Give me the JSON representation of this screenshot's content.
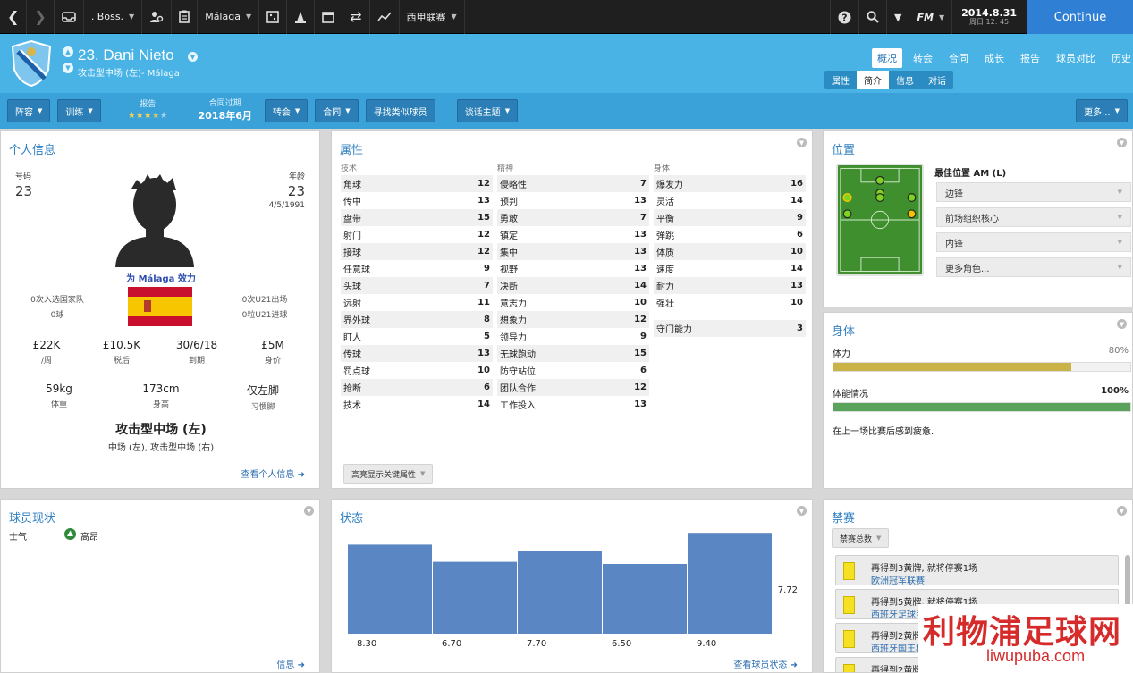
{
  "topbar": {
    "manager": ". Boss.",
    "club": "Málaga",
    "league": "西甲联赛",
    "game_menu": "FM",
    "date": "2014.8.31",
    "day_time": "周日 12: 45",
    "continue_label": "Continue"
  },
  "player": {
    "name": "23. Dani Nieto",
    "subtitle": "攻击型中场 (左)- Málaga"
  },
  "main_tabs": [
    "概况",
    "转会",
    "合同",
    "成长",
    "报告",
    "球员对比",
    "历史"
  ],
  "sub_tabs": [
    "属性",
    "简介",
    "信息",
    "对话"
  ],
  "actionbar": {
    "squad": "阵容",
    "training": "训练",
    "report_label": "报告",
    "stars_on": 3.5,
    "contract_label": "合同过期",
    "contract_value": "2018年6月",
    "transfer": "转会",
    "contract": "合同",
    "similar": "寻找类似球员",
    "talk": "谈话主题",
    "more": "更多..."
  },
  "info": {
    "title": "个人信息",
    "number_label": "号码",
    "number": "23",
    "age_label": "年龄",
    "age": "23",
    "dob": "4/5/1991",
    "plays_for": "为 Málaga 效力",
    "caps": "0次入选国家队",
    "goals": "0球",
    "u21_caps": "0次U21出场",
    "u21_goals": "0粒U21进球",
    "stats": [
      {
        "value": "£22K",
        "label": "/周"
      },
      {
        "value": "£10.5K",
        "label": "税后"
      },
      {
        "value": "30/6/18",
        "label": "到期"
      },
      {
        "value": "£5M",
        "label": "身价"
      }
    ],
    "weight": "59kg",
    "weight_label": "体重",
    "height": "173cm",
    "height_label": "身高",
    "foot": "仅左脚",
    "foot_label": "习惯脚",
    "position": "攻击型中场 (左)",
    "positions": "中场 (左), 攻击型中场 (右)",
    "link": "查看个人信息"
  },
  "attributes": {
    "title": "属性",
    "technical_header": "技术",
    "mental_header": "精神",
    "physical_header": "身体",
    "technical": [
      {
        "name": "角球",
        "value": "12"
      },
      {
        "name": "传中",
        "value": "13"
      },
      {
        "name": "盘带",
        "value": "15"
      },
      {
        "name": "射门",
        "value": "12"
      },
      {
        "name": "接球",
        "value": "12"
      },
      {
        "name": "任意球",
        "value": "9"
      },
      {
        "name": "头球",
        "value": "7"
      },
      {
        "name": "远射",
        "value": "11"
      },
      {
        "name": "界外球",
        "value": "8"
      },
      {
        "name": "盯人",
        "value": "5"
      },
      {
        "name": "传球",
        "value": "13"
      },
      {
        "name": "罚点球",
        "value": "10"
      },
      {
        "name": "抢断",
        "value": "6"
      },
      {
        "name": "技术",
        "value": "14"
      }
    ],
    "mental": [
      {
        "name": "侵略性",
        "value": "7"
      },
      {
        "name": "预判",
        "value": "13"
      },
      {
        "name": "勇敢",
        "value": "7"
      },
      {
        "name": "镇定",
        "value": "13"
      },
      {
        "name": "集中",
        "value": "13"
      },
      {
        "name": "视野",
        "value": "13"
      },
      {
        "name": "决断",
        "value": "14"
      },
      {
        "name": "意志力",
        "value": "10"
      },
      {
        "name": "想象力",
        "value": "12"
      },
      {
        "name": "领导力",
        "value": "9"
      },
      {
        "name": "无球跑动",
        "value": "15"
      },
      {
        "name": "防守站位",
        "value": "6"
      },
      {
        "name": "团队合作",
        "value": "12"
      },
      {
        "name": "工作投入",
        "value": "13"
      }
    ],
    "physical": [
      {
        "name": "爆发力",
        "value": "16"
      },
      {
        "name": "灵活",
        "value": "14"
      },
      {
        "name": "平衡",
        "value": "9"
      },
      {
        "name": "弹跳",
        "value": "6"
      },
      {
        "name": "体质",
        "value": "10"
      },
      {
        "name": "速度",
        "value": "14"
      },
      {
        "name": "耐力",
        "value": "13"
      },
      {
        "name": "强壮",
        "value": "10"
      }
    ],
    "goalkeeping": {
      "name": "守门能力",
      "value": "3"
    },
    "highlight_btn": "高亮显示关键属性"
  },
  "position": {
    "title": "位置",
    "best": "最佳位置 AM (L)",
    "roles": [
      "边锋",
      "前场组织核心",
      "内锋",
      "更多角色..."
    ]
  },
  "physical_panel": {
    "title": "身体",
    "fitness_label": "体力",
    "fitness_value": "80%",
    "fitness_pct": 80,
    "condition_label": "体能情况",
    "condition_value": "100%",
    "condition_pct": 100,
    "note": "在上一场比赛后感到疲惫.",
    "colors": {
      "fitness": "#c9b347",
      "condition": "#5aa35a"
    }
  },
  "status": {
    "title": "球员现状",
    "morale_label": "士气",
    "morale_value": "高昂",
    "link": "信息"
  },
  "form": {
    "title": "状态",
    "average": "7.72",
    "link": "查看球员状态"
  },
  "chart_data": {
    "type": "bar",
    "values": [
      8.3,
      6.7,
      7.7,
      6.5,
      9.4
    ],
    "value_labels": [
      "8.30",
      "6.70",
      "7.70",
      "6.50",
      "9.40"
    ],
    "ylim": [
      0,
      10
    ],
    "average": 7.72
  },
  "bans": {
    "title": "禁赛",
    "filter": "禁赛总数",
    "items": [
      {
        "text": "再得到3黄牌, 就将停赛1场",
        "competition": "欧洲冠军联赛"
      },
      {
        "text": "再得到5黄牌, 就将停赛1场",
        "competition": "西班牙足球甲级联赛"
      },
      {
        "text": "再得到2黄牌",
        "competition": "西班牙国王杯"
      },
      {
        "text": "再得到2黄牌",
        "competition": ""
      }
    ]
  },
  "watermark": {
    "cn": "利物浦足球网",
    "en": "liwupuba.com"
  }
}
